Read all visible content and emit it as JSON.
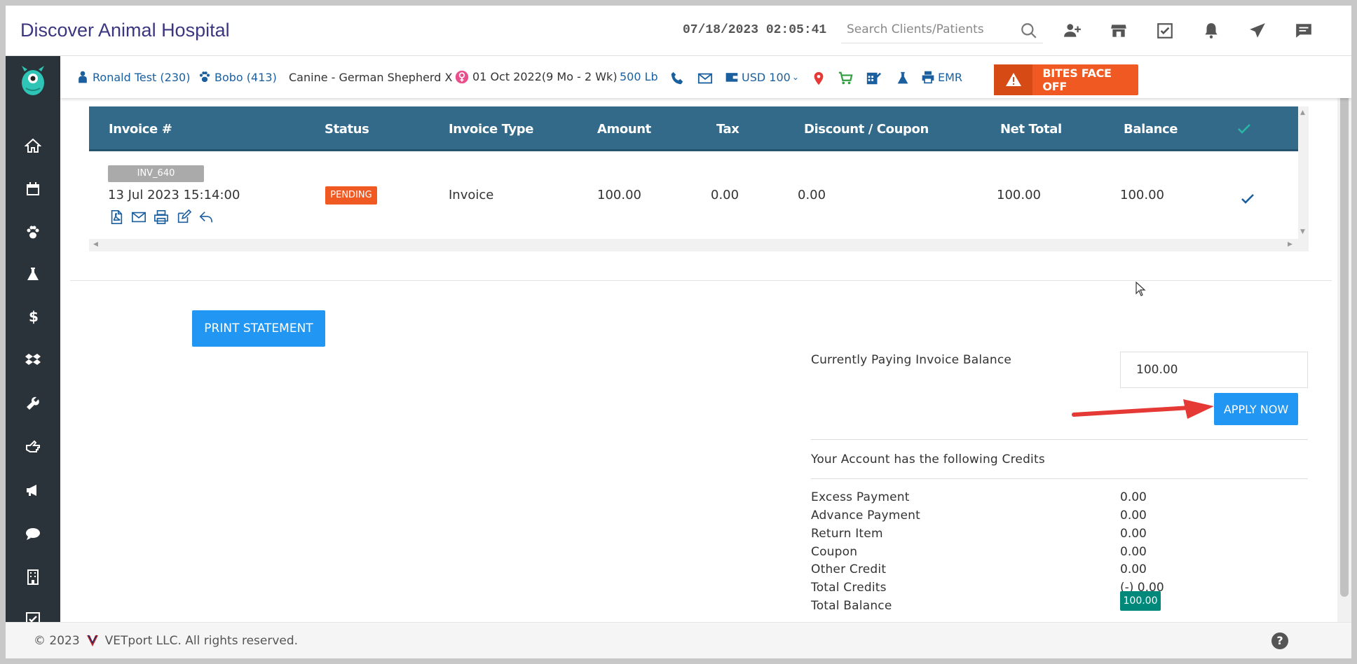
{
  "header": {
    "brand": "Discover Animal Hospital",
    "datetime": "07/18/2023 02:05:41",
    "search_placeholder": "Search Clients/Patients"
  },
  "patient_bar": {
    "client": "Ronald Test (230)",
    "patient": "Bobo (413)",
    "breed": "Canine - German Shepherd X",
    "dob": "01 Oct 2022(9 Mo - 2 Wk)",
    "weight": "500 Lb",
    "currency": "USD 100",
    "emr": "EMR",
    "alert": "BITES FACE OFF"
  },
  "table": {
    "headers": [
      "Invoice #",
      "Status",
      "Invoice Type",
      "Amount",
      "Tax",
      "Discount / Coupon",
      "Net Total",
      "Balance"
    ],
    "rows": [
      {
        "invoice_id": "INV_640",
        "date": "13 Jul 2023 15:14:00",
        "status": "PENDING",
        "type": "Invoice",
        "amount": "100.00",
        "tax": "0.00",
        "discount": "0.00",
        "net_total": "100.00",
        "balance": "100.00"
      }
    ]
  },
  "actions": {
    "print_statement": "PRINT STATEMENT",
    "apply_now": "APPLY NOW"
  },
  "payment": {
    "label": "Currently Paying Invoice Balance",
    "value": "100.00"
  },
  "credits": {
    "heading": "Your Account has the following Credits",
    "items": [
      {
        "label": "Excess Payment",
        "value": "0.00"
      },
      {
        "label": "Advance Payment",
        "value": "0.00"
      },
      {
        "label": "Return Item",
        "value": "0.00"
      },
      {
        "label": "Coupon",
        "value": "0.00"
      },
      {
        "label": "Other Credit",
        "value": "0.00"
      },
      {
        "label": "Total Credits",
        "value": "(-) 0.00"
      }
    ],
    "total_balance_label": "Total Balance",
    "total_balance_value": "100.00"
  },
  "footer": {
    "copyright": "© 2023",
    "company": "VETport LLC. All rights reserved.",
    "help": "?"
  },
  "colors": {
    "table_header": "#336a8a",
    "accent": "#2196f3",
    "alert": "#f05a22",
    "sidebar": "#2b333a",
    "balance_badge": "#00897b"
  }
}
